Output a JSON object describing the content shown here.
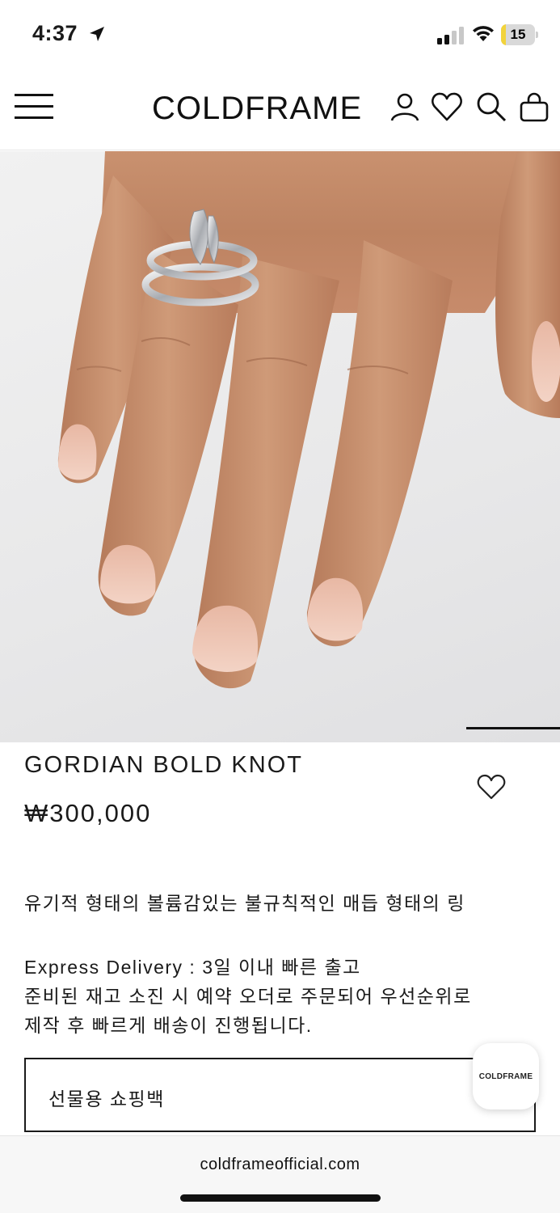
{
  "status_bar": {
    "time": "4:37",
    "battery_level": "15",
    "battery_fraction": 0.15,
    "icons": [
      "location-arrow-icon",
      "cellular-signal-icon",
      "wifi-icon",
      "battery-icon"
    ]
  },
  "header": {
    "logo": "COLDFRAME",
    "icons": [
      "hamburger-menu-icon",
      "account-icon",
      "wishlist-heart-icon",
      "search-icon",
      "shopping-bag-icon"
    ]
  },
  "hero": {
    "image": "ring-on-hand-photo",
    "slide_indicator_icon": "slide-progress-bar"
  },
  "product": {
    "name": "GORDIAN BOLD KNOT",
    "price": "₩300,000",
    "description": "유기적 형태의 볼륨감있는 불규칙적인 매듭 형태의 링",
    "delivery_lines": [
      "Express Delivery : 3일 이내 빠른 출고",
      "준비된 재고 소진 시 예약 오더로 주문되어 우선순위로",
      "제작 후 빠르게 배송이 진행됩니다."
    ],
    "option_label": "선물용 쇼핑백"
  },
  "chat": {
    "label": "COLDFRAME"
  },
  "browser": {
    "url": "coldframeofficial.com"
  },
  "colors": {
    "text": "#1a1a1a",
    "background": "#ffffff",
    "battery_low": "#f2d33b"
  }
}
